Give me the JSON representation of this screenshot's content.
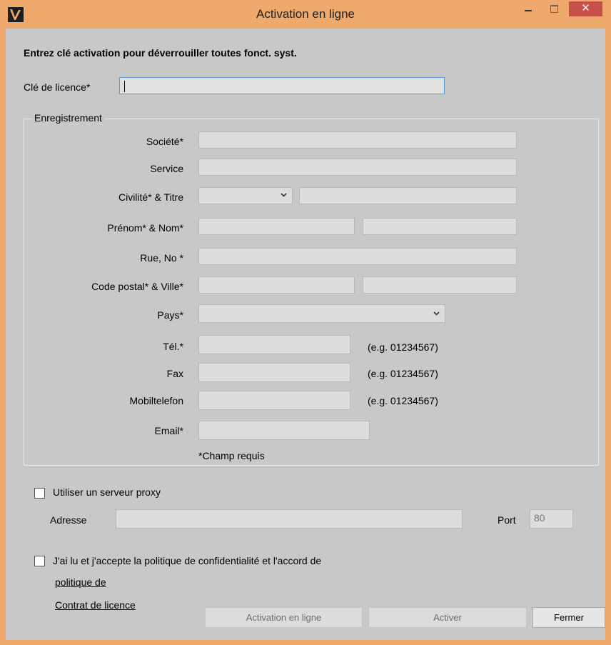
{
  "window": {
    "title": "Activation en ligne",
    "logo_icon": "app-logo-icon",
    "controls": {
      "minimize": "minimize-icon",
      "maximize": "maximize-icon",
      "close": "close-icon"
    }
  },
  "intro": "Entrez clé activation pour déverrouiller toutes fonct. syst.",
  "license": {
    "label": "Clé de licence*",
    "value": ""
  },
  "registration": {
    "group_title": "Enregistrement",
    "labels": {
      "company": "Société*",
      "service": "Service",
      "salutation_title": "Civilité* & Titre",
      "name": "Prénom* & Nom*",
      "street": "Rue, No *",
      "postal_city": "Code postal* & Ville*",
      "country": "Pays*",
      "phone": "Tél.*",
      "fax": "Fax",
      "mobile": "Mobiltelefon",
      "email": "Email*"
    },
    "hints": {
      "phone": "(e.g. 01234567)",
      "fax": "(e.g. 01234567)",
      "mobile": "(e.g. 01234567)"
    },
    "required_note": "*Champ requis"
  },
  "proxy": {
    "checkbox_label": "Utiliser un serveur proxy",
    "checked": false,
    "address_label": "Adresse",
    "address_value": "",
    "port_label": "Port",
    "port_value": "80"
  },
  "agreement": {
    "checkbox_label": "J'ai lu et j'accepte la politique de confidentialité et l'accord de",
    "checked": false,
    "link_policy": "politique de ",
    "link_license": "Contrat de licence"
  },
  "buttons": {
    "online_activation": "Activation en ligne",
    "activate": "Activer",
    "close": "Fermer"
  },
  "colors": {
    "title_bar": "#efa96c",
    "close_button": "#c7504a",
    "client_bg": "#c8c8c8",
    "focus_border": "#5a9ae0"
  }
}
